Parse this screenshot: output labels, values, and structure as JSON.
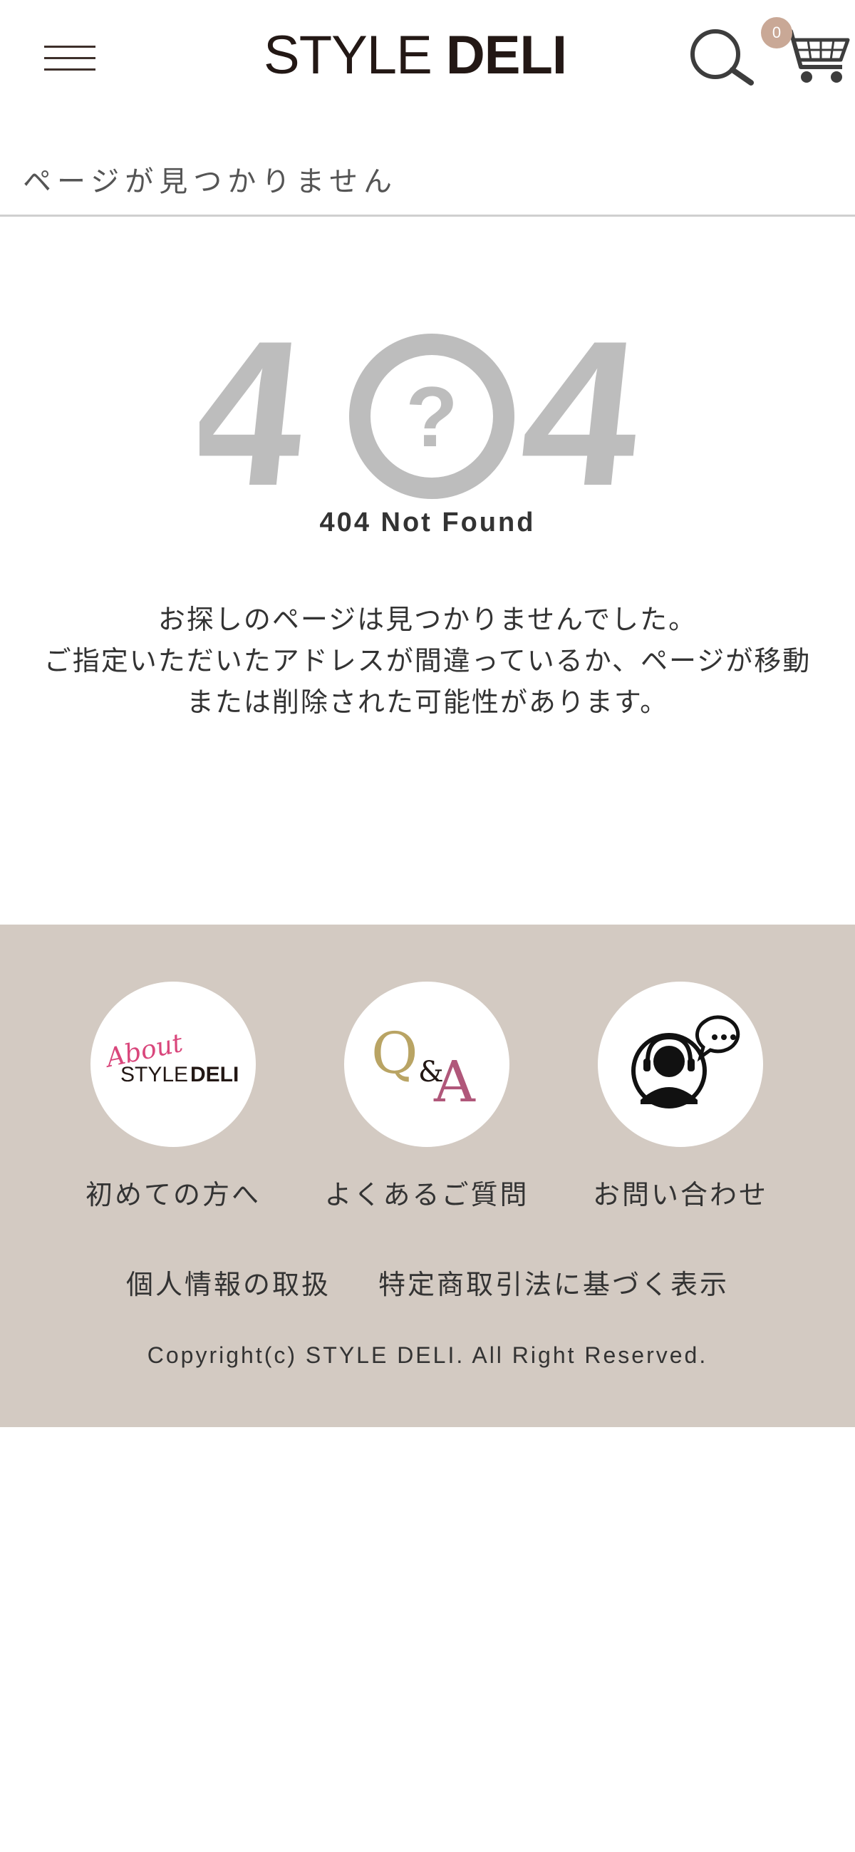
{
  "header": {
    "logo_light": "STYLE",
    "logo_bold": "DELI",
    "cart_count": "0",
    "menu_icon": "hamburger-icon",
    "search_icon": "search-icon",
    "cart_icon": "cart-icon"
  },
  "page_heading": "ページが見つかりません",
  "error": {
    "code_left": "4",
    "code_center": "?",
    "code_right": "4",
    "subtitle": "404 Not Found",
    "message_lines": [
      "お探しのページは見つかりませんでした。",
      "ご指定いただいたアドレスが間違っているか、ページが移動",
      "または削除された可能性があります。"
    ]
  },
  "footer": {
    "items": [
      {
        "label": "初めての方へ",
        "badge_script": "About",
        "badge_light": "STYLE",
        "badge_bold": "DELI"
      },
      {
        "label": "よくあるご質問",
        "badge_q": "Q",
        "badge_amp": "&",
        "badge_a": "A"
      },
      {
        "label": "お問い合わせ",
        "icon": "support-operator-icon"
      }
    ],
    "links": [
      "個人情報の取扱",
      "特定商取引法に基づく表示"
    ],
    "copyright": "Copyright(c) STYLE DELI. All Right Reserved."
  },
  "colors": {
    "footer_bg": "#d3cac2",
    "logo_text": "#231815",
    "error_gray": "#bdbdbd",
    "badge": "#c9a896",
    "qa_gold": "#b9a464",
    "qa_rose": "#b0577a",
    "about_pink": "#d9477c"
  }
}
